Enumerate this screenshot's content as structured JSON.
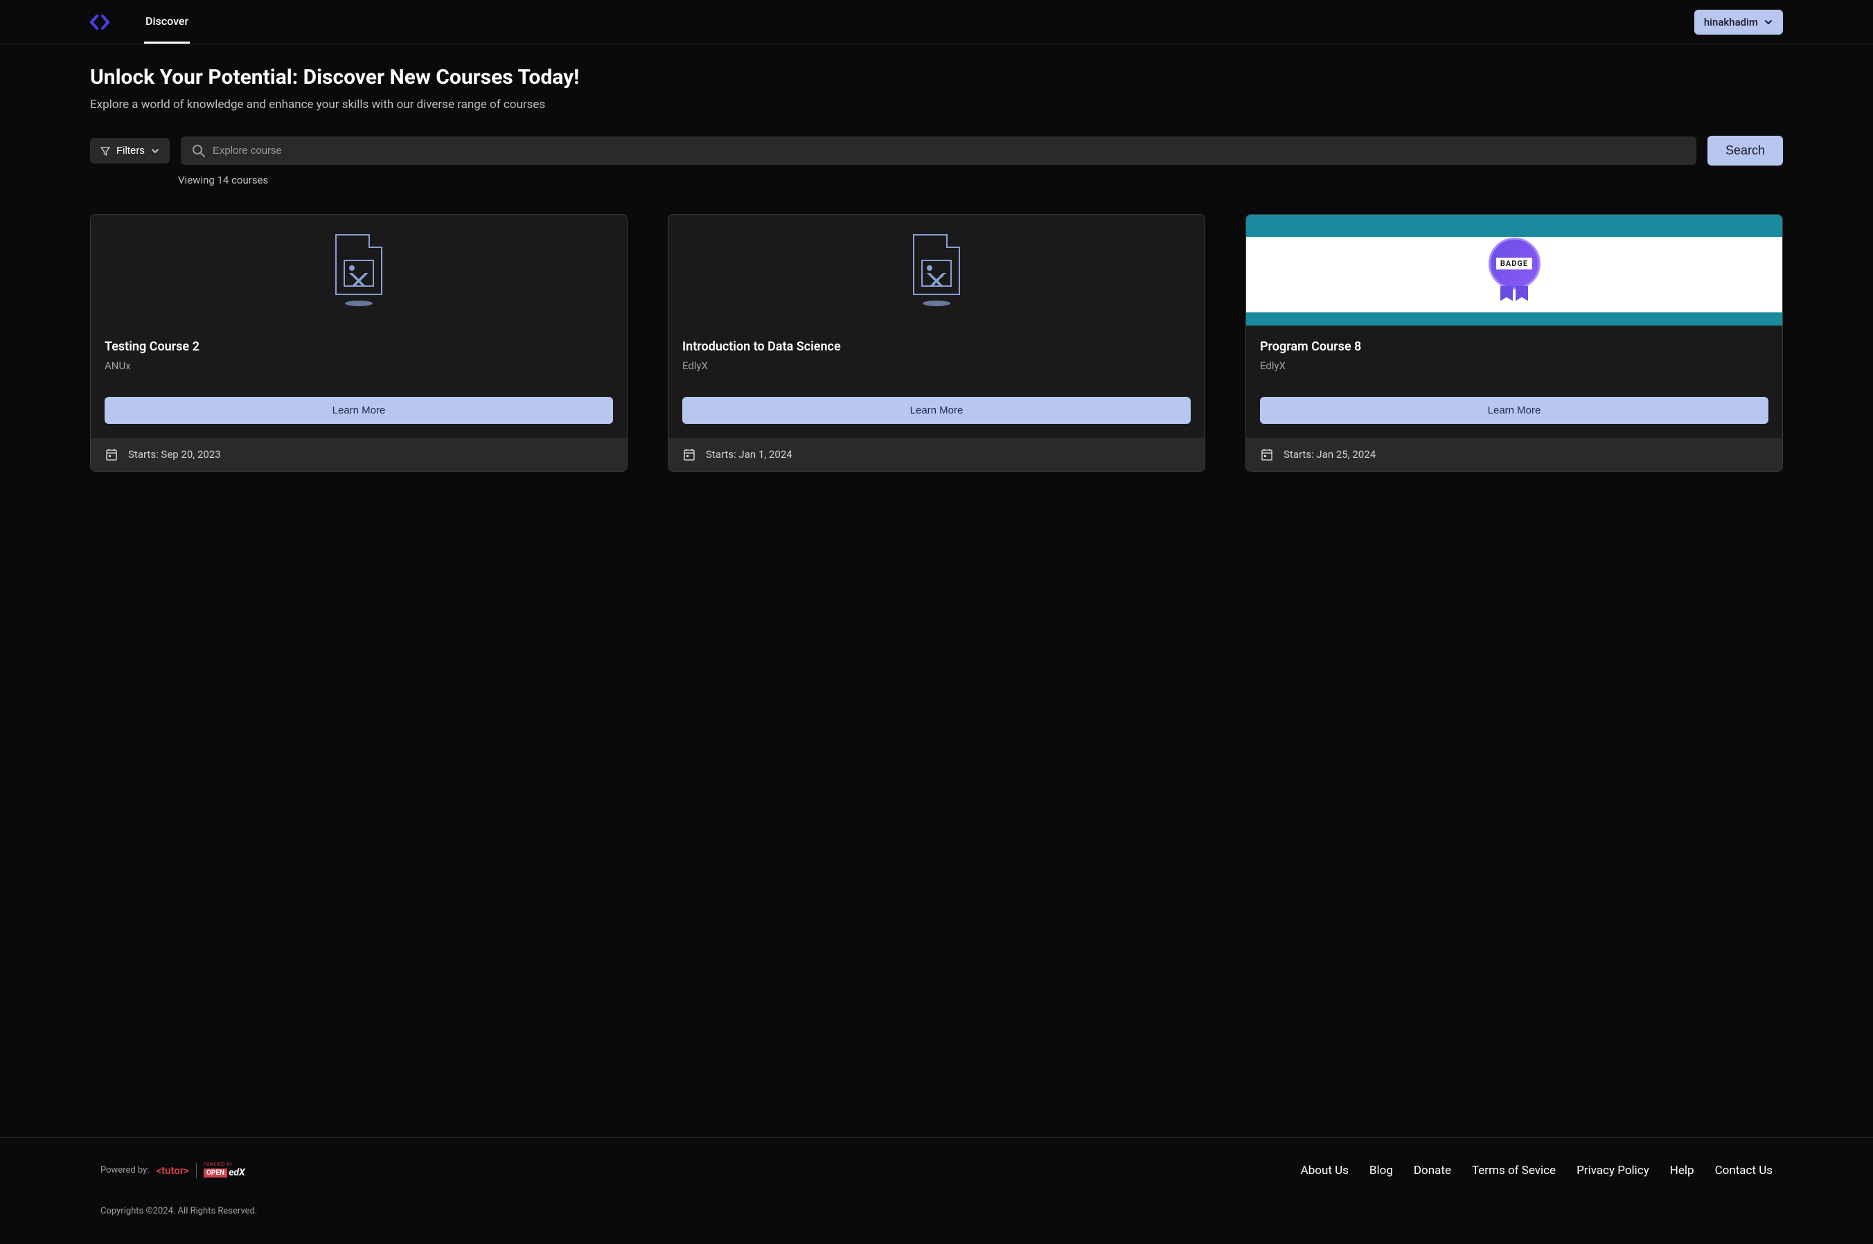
{
  "header": {
    "nav_tab": "Discover",
    "username": "hinakhadim"
  },
  "page": {
    "title": "Unlock Your Potential: Discover New Courses Today!",
    "subtitle": "Explore a world of knowledge and enhance your skills with our diverse range of courses"
  },
  "search": {
    "filters_label": "Filters",
    "placeholder": "Explore course",
    "button_label": "Search",
    "results_count": "Viewing 14 courses"
  },
  "courses": [
    {
      "title": "Testing Course 2",
      "provider": "ANUx",
      "cta": "Learn More",
      "date": "Starts: Sep 20, 2023",
      "hasBadge": false
    },
    {
      "title": "Introduction to Data Science",
      "provider": "EdlyX",
      "cta": "Learn More",
      "date": "Starts: Jan 1, 2024",
      "hasBadge": false
    },
    {
      "title": "Program Course 8",
      "provider": "EdlyX",
      "cta": "Learn More",
      "date": "Starts: Jan 25, 2024",
      "hasBadge": true
    }
  ],
  "badge": {
    "label": "BADGE"
  },
  "footer": {
    "powered_by": "Powered by:",
    "tutor": "<tutor>",
    "open_label": "OPEN",
    "edx_label": "edX",
    "powered_by_small": "POWERED BY",
    "links": [
      "About Us",
      "Blog",
      "Donate",
      "Terms of Sevice",
      "Privacy Policy",
      "Help",
      "Contact Us"
    ],
    "copyright": "Copyrights ©2024. All Rights Reserved."
  }
}
